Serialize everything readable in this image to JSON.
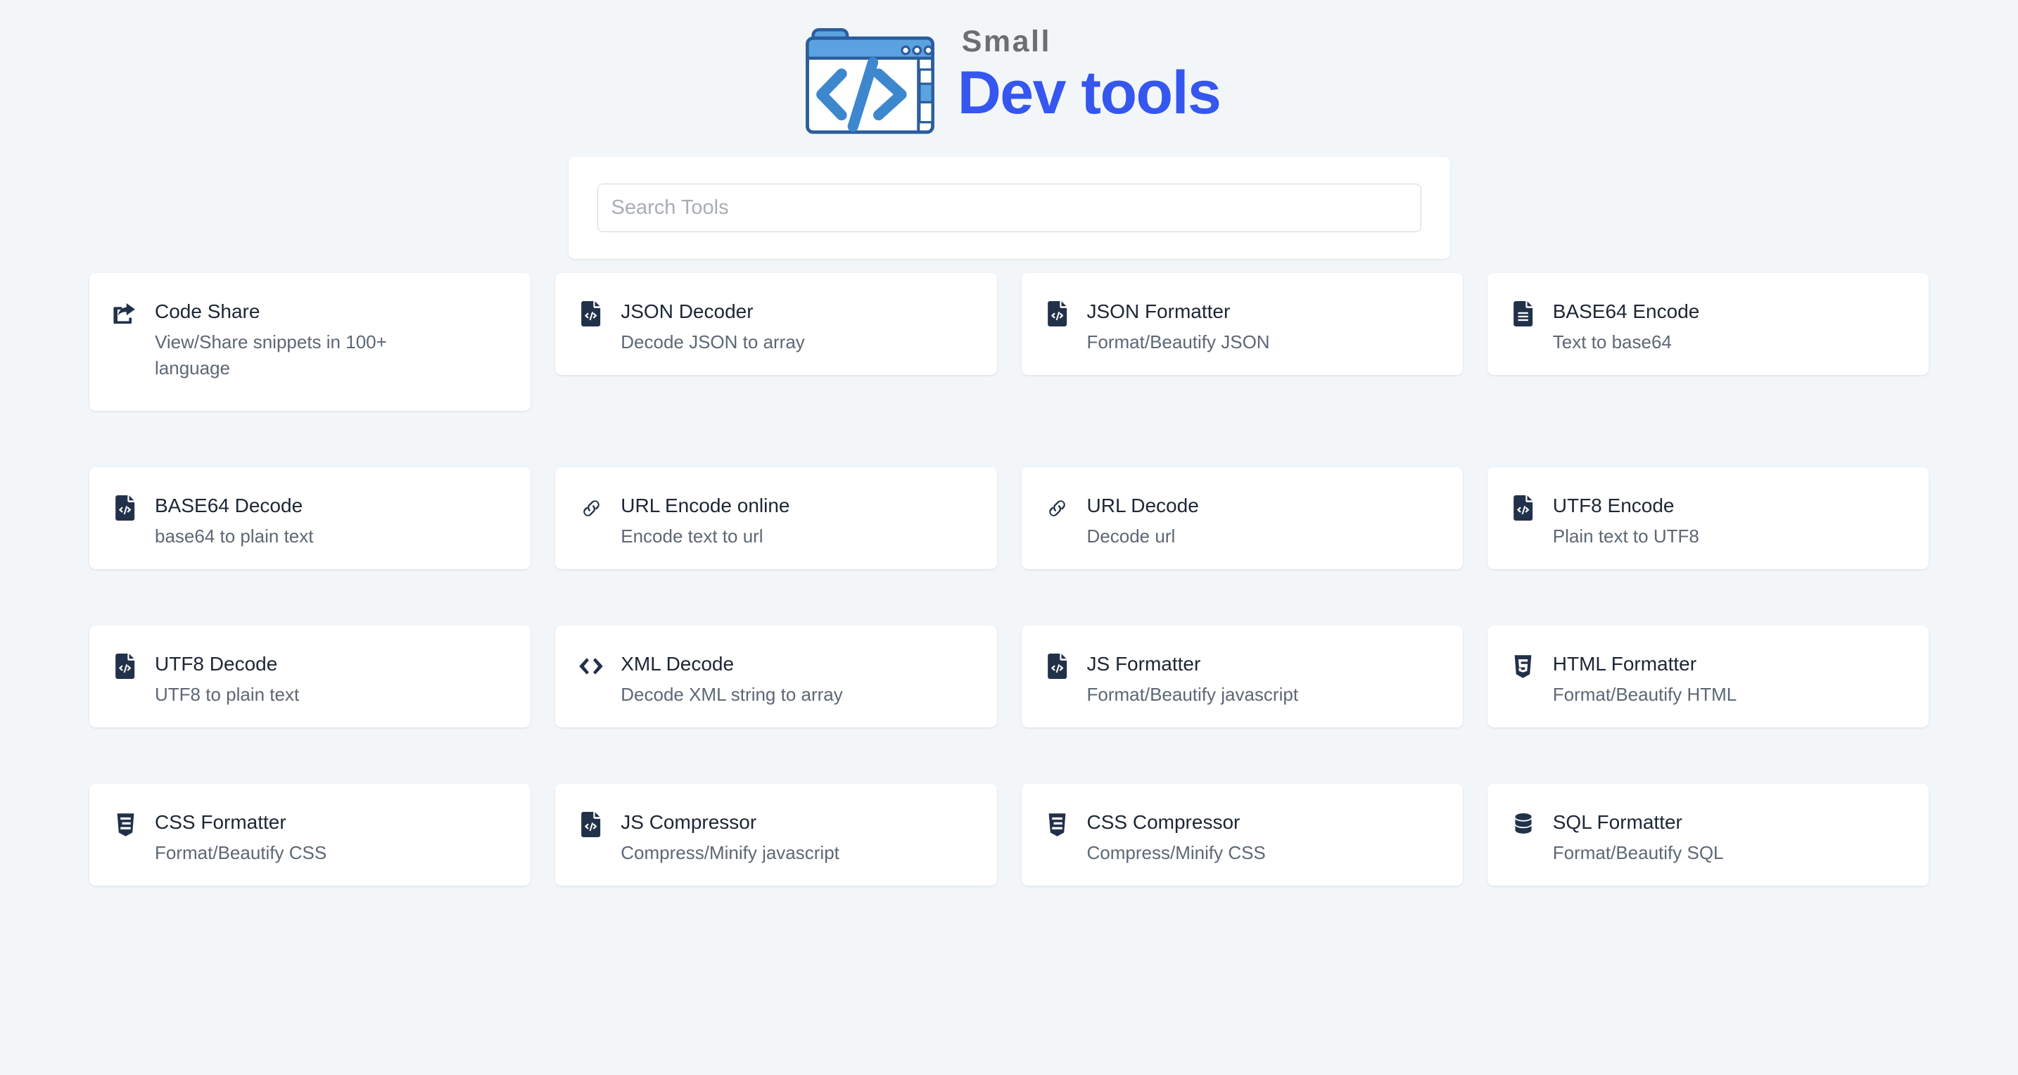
{
  "brand": {
    "small_word": "Small",
    "main_word": "Dev tools",
    "logo_icon": "code-window-folder-logo",
    "accent_color": "#3556ef",
    "small_word_color": "#6e6e6e",
    "logo_blue": "#5ba3e0",
    "logo_outline": "#2b5d9e"
  },
  "page": {
    "background_color": "#f2f6f9",
    "card_background": "#ffffff"
  },
  "search": {
    "placeholder": "Search Tools",
    "value": "",
    "focused": true
  },
  "tools": [
    {
      "title": "Code Share",
      "desc": "View/Share snippets in 100+ language",
      "icon": "share-square-icon",
      "tall": true
    },
    {
      "title": "JSON Decoder",
      "desc": "Decode JSON to array",
      "icon": "file-code-icon",
      "tall": false
    },
    {
      "title": "JSON Formatter",
      "desc": "Format/Beautify JSON",
      "icon": "file-code-icon",
      "tall": false
    },
    {
      "title": "BASE64 Encode",
      "desc": "Text to base64",
      "icon": "file-lines-icon",
      "tall": false
    },
    {
      "title": "BASE64 Decode",
      "desc": "base64 to plain text",
      "icon": "file-code-icon",
      "tall": false
    },
    {
      "title": "URL Encode online",
      "desc": "Encode text to url",
      "icon": "link-icon",
      "tall": false
    },
    {
      "title": "URL Decode",
      "desc": "Decode url",
      "icon": "link-icon",
      "tall": false
    },
    {
      "title": "UTF8 Encode",
      "desc": "Plain text to UTF8",
      "icon": "file-code-icon",
      "tall": false
    },
    {
      "title": "UTF8 Decode",
      "desc": "UTF8 to plain text",
      "icon": "file-code-icon",
      "tall": false
    },
    {
      "title": "XML Decode",
      "desc": "Decode XML string to array",
      "icon": "code-brackets-icon",
      "tall": false
    },
    {
      "title": "JS Formatter",
      "desc": "Format/Beautify javascript",
      "icon": "file-code-icon",
      "tall": false
    },
    {
      "title": "HTML Formatter",
      "desc": "Format/Beautify HTML",
      "icon": "html5-shield-icon",
      "tall": false
    },
    {
      "title": "CSS Formatter",
      "desc": "Format/Beautify CSS",
      "icon": "css3-shield-icon",
      "tall": false
    },
    {
      "title": "JS Compressor",
      "desc": "Compress/Minify javascript",
      "icon": "file-code-icon",
      "tall": false
    },
    {
      "title": "CSS Compressor",
      "desc": "Compress/Minify CSS",
      "icon": "css3-shield-icon",
      "tall": false
    },
    {
      "title": "SQL Formatter",
      "desc": "Format/Beautify SQL",
      "icon": "database-icon",
      "tall": false
    }
  ]
}
